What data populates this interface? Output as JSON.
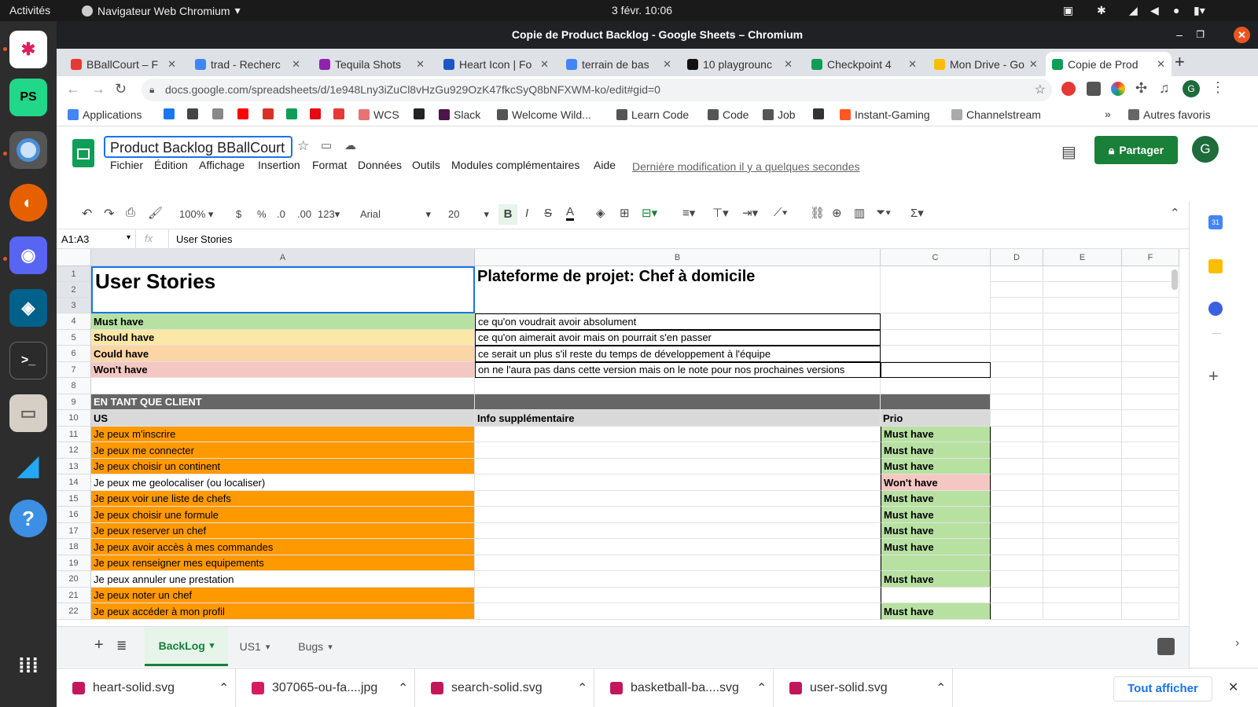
{
  "topbar": {
    "activities": "Activités",
    "app_name": "Navigateur Web Chromium",
    "clock": "3 févr.  10:06"
  },
  "window": {
    "title": "Copie de Product Backlog - Google Sheets – Chromium"
  },
  "tabs": [
    {
      "label": "BBallCourt – F",
      "color": "#e53935"
    },
    {
      "label": "trad - Recherc",
      "color": "#4285f4"
    },
    {
      "label": "Tequila Shots",
      "color": "#8e24aa"
    },
    {
      "label": "Heart Icon | Fo",
      "color": "#1e56c4"
    },
    {
      "label": "terrain de bas",
      "color": "#4285f4"
    },
    {
      "label": "10 playgrounc",
      "color": "#111111"
    },
    {
      "label": "Checkpoint 4",
      "color": "#0f9d58"
    },
    {
      "label": "Mon Drive - Go",
      "color": "#fbbc04"
    },
    {
      "label": "Copie de Prod",
      "color": "#0f9d58",
      "active": true
    }
  ],
  "url": "docs.google.com/spreadsheets/d/1e948Lny3iZuCl8vHzGu929OzK47fkcSyQ8bNFXWM-ko/edit#gid=0",
  "bookmarks": [
    {
      "label": "Applications",
      "color": "#4285f4"
    },
    {
      "label": "",
      "color": "#1877f2"
    },
    {
      "label": "",
      "color": "#444444"
    },
    {
      "label": "",
      "color": "#888888"
    },
    {
      "label": "",
      "color": "#ff0000"
    },
    {
      "label": "",
      "color": "#d93025"
    },
    {
      "label": "",
      "color": "#0f9d58"
    },
    {
      "label": "",
      "color": "#e50914"
    },
    {
      "label": "",
      "color": "#e53935"
    },
    {
      "label": "WCS",
      "color": "#e57373"
    },
    {
      "label": "",
      "color": "#222222"
    },
    {
      "label": "Slack",
      "color": "#4a154b"
    },
    {
      "label": "Welcome Wild...",
      "color": "#555555"
    },
    {
      "label": "Learn Code",
      "color": "#555555"
    },
    {
      "label": "Code",
      "color": "#555555"
    },
    {
      "label": "Job",
      "color": "#555555"
    },
    {
      "label": "",
      "color": "#333333"
    },
    {
      "label": "Instant-Gaming",
      "color": "#ff5722"
    },
    {
      "label": "Channelstream",
      "color": "#aaaaaa"
    }
  ],
  "bookmarks_more": "»",
  "other_bookmarks": "Autres favoris",
  "sheets": {
    "doc_title": "Product Backlog BBallCourt",
    "menus": [
      "Fichier",
      "Édition",
      "Affichage",
      "Insertion",
      "Format",
      "Données",
      "Outils",
      "Modules complémentaires",
      "Aide"
    ],
    "last_modified": "Dernière modification il y a quelques secondes",
    "share_label": "Partager",
    "avatar": "G",
    "zoom": "100%",
    "currency": "$",
    "percent": "%",
    "dec_less": ".0",
    "dec_more": ".00",
    "number_format": "123",
    "font": "Arial",
    "font_size": "20",
    "cell_ref": "A1:A3",
    "fx": "fx",
    "formula_value": "User Stories",
    "columns": [
      "A",
      "B",
      "C",
      "D",
      "E",
      "F"
    ],
    "rows": [
      {
        "n": "1",
        "a": "User Stories",
        "b": "Plateforme de projet: Chef à domicile",
        "c": "",
        "style": "header"
      },
      {
        "n": "2",
        "a": "",
        "b": "",
        "c": "",
        "style": "header"
      },
      {
        "n": "3",
        "a": "",
        "b": "",
        "c": "",
        "style": "header"
      },
      {
        "n": "4",
        "a": "Must have",
        "b": " ce qu'on voudrait avoir absolument",
        "c": "",
        "style": "must"
      },
      {
        "n": "5",
        "a": "Should have",
        "b": "ce qu'on aimerait avoir mais on pourrait s'en passer",
        "c": "",
        "style": "should"
      },
      {
        "n": "6",
        "a": "Could have",
        "b": "ce serait un plus s'il reste du temps de développement à l'équipe",
        "c": "",
        "style": "could"
      },
      {
        "n": "7",
        "a": "Won't have",
        "b": "on ne l'aura pas dans cette version mais on le note pour nos prochaines versions",
        "c": "",
        "style": "wont"
      },
      {
        "n": "8",
        "a": "",
        "b": "",
        "c": "",
        "style": "plain"
      },
      {
        "n": "9",
        "a": "EN TANT QUE CLIENT",
        "b": "",
        "c": "",
        "style": "section"
      },
      {
        "n": "10",
        "a": "US",
        "b": "Info supplémentaire",
        "c": "Prio",
        "style": "colhead"
      },
      {
        "n": "11",
        "a": "Je peux m'inscrire",
        "b": "",
        "c": "Must have",
        "style": "us",
        "a_bg": "orange",
        "c_bg": "green"
      },
      {
        "n": "12",
        "a": "Je peux me connecter",
        "b": "",
        "c": "Must have",
        "style": "us",
        "a_bg": "orange",
        "c_bg": "green"
      },
      {
        "n": "13",
        "a": "Je peux choisir un continent",
        "b": "",
        "c": "Must have",
        "style": "us",
        "a_bg": "orange",
        "c_bg": "green"
      },
      {
        "n": "14",
        "a": "Je peux me geolocaliser (ou localiser)",
        "b": "",
        "c": "Won't have",
        "style": "us",
        "a_bg": "white",
        "c_bg": "pink"
      },
      {
        "n": "15",
        "a": "Je peux voir une liste de chefs",
        "b": "",
        "c": "Must have",
        "style": "us",
        "a_bg": "orange",
        "c_bg": "green"
      },
      {
        "n": "16",
        "a": "Je peux choisir une formule",
        "b": "",
        "c": "Must have",
        "style": "us",
        "a_bg": "orange",
        "c_bg": "green"
      },
      {
        "n": "17",
        "a": "Je peux reserver un chef",
        "b": "",
        "c": "Must have",
        "style": "us",
        "a_bg": "orange",
        "c_bg": "green"
      },
      {
        "n": "18",
        "a": "Je peux avoir accès à mes commandes",
        "b": "",
        "c": "Must have",
        "style": "us",
        "a_bg": "orange",
        "c_bg": "green"
      },
      {
        "n": "19",
        "a": "Je peux renseigner mes equipements",
        "b": "",
        "c": "",
        "style": "us",
        "a_bg": "orange",
        "c_bg": "green"
      },
      {
        "n": "20",
        "a": "Je peux annuler une prestation",
        "b": "",
        "c": "Must have",
        "style": "us",
        "a_bg": "white",
        "c_bg": "green"
      },
      {
        "n": "21",
        "a": "Je peux noter un chef",
        "b": "",
        "c": "",
        "style": "us",
        "a_bg": "orange",
        "c_bg": "white"
      },
      {
        "n": "22",
        "a": "Je peux accéder à mon profil",
        "b": "",
        "c": "Must have",
        "style": "us",
        "a_bg": "orange",
        "c_bg": "green"
      }
    ],
    "sheet_tabs": [
      "BackLog",
      "US1",
      "Bugs"
    ],
    "active_sheet": "BackLog"
  },
  "downloads": [
    {
      "name": "heart-solid.svg",
      "color": "#c2185b"
    },
    {
      "name": "307065-ou-fa....jpg",
      "color": "#d81b60"
    },
    {
      "name": "search-solid.svg",
      "color": "#c2185b"
    },
    {
      "name": "basketball-ba....svg",
      "color": "#c2185b"
    },
    {
      "name": "user-solid.svg",
      "color": "#c2185b"
    }
  ],
  "show_all_downloads": "Tout afficher",
  "colors": {
    "must": "#b7e1a1",
    "should": "#fce8a6",
    "could": "#fcd5a6",
    "wont": "#f4c7c3",
    "orange": "#ff9900",
    "section": "#666666",
    "colhead": "#d9d9d9",
    "share": "#188038"
  }
}
